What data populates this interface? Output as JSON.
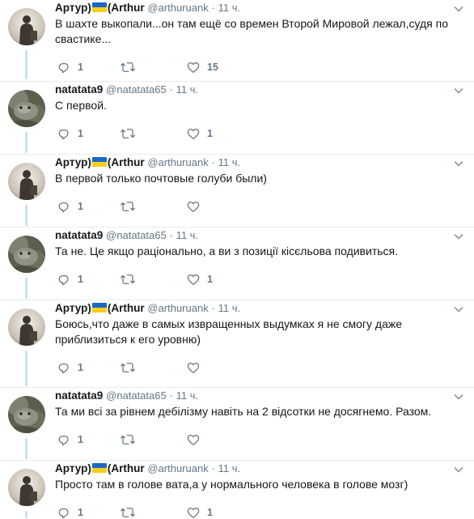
{
  "tweets": [
    {
      "author": "arthur",
      "name": "Артур)",
      "name2": "(Arthur",
      "handle": "@arthuruank",
      "dot": "·",
      "time": "11 ч.",
      "lines": [
        "В шахте выкопали...он там ещё со времен Второй Мировой лежал,судя по",
        "свастике..."
      ],
      "replies": "1",
      "retweets": "",
      "likes": "15"
    },
    {
      "author": "natatata",
      "name": "natatata9",
      "name2": "",
      "handle": "@natatata65",
      "dot": "·",
      "time": "11 ч.",
      "lines": [
        "С первой."
      ],
      "replies": "1",
      "retweets": "",
      "likes": "1"
    },
    {
      "author": "arthur",
      "name": "Артур)",
      "name2": "(Arthur",
      "handle": "@arthuruank",
      "dot": "·",
      "time": "11 ч.",
      "lines": [
        "В первой только почтовые голуби были)"
      ],
      "replies": "1",
      "retweets": "",
      "likes": ""
    },
    {
      "author": "natatata",
      "name": "natatata9",
      "name2": "",
      "handle": "@natatata65",
      "dot": "·",
      "time": "11 ч.",
      "lines": [
        "Та не. Це якщо раціонально, а ви з позиції кісєльова подивиться."
      ],
      "replies": "1",
      "retweets": "",
      "likes": "1"
    },
    {
      "author": "arthur",
      "name": "Артур)",
      "name2": "(Arthur",
      "handle": "@arthuruank",
      "dot": "·",
      "time": "11 ч.",
      "lines": [
        "Боюсь,что даже в самых извращенных выдумках я не смогу даже",
        "приблизиться к его уровню)"
      ],
      "replies": "1",
      "retweets": "",
      "likes": ""
    },
    {
      "author": "natatata",
      "name": "natatata9",
      "name2": "",
      "handle": "@natatata65",
      "dot": "·",
      "time": "11 ч.",
      "lines": [
        "Та ми всі за рівнем дебілізму навіть на 2 відсотки не досягнемо.  Разом."
      ],
      "replies": "1",
      "retweets": "",
      "likes": ""
    },
    {
      "author": "arthur",
      "name": "Артур)",
      "name2": "(Arthur",
      "handle": "@arthuruank",
      "dot": "·",
      "time": "11 ч.",
      "lines": [
        "Просто там в голове вата,а у нормального человека в голове мозг)"
      ],
      "replies": "1",
      "retweets": "",
      "likes": "1"
    }
  ],
  "colors": {
    "icon_gray": "#657786",
    "thread_line": "#c4e3f5",
    "divider": "#e6ecf0",
    "flag_blue": "#1a68c9",
    "flag_yellow": "#f7cf1d"
  },
  "icons": {
    "reply": "reply-icon",
    "retweet": "retweet-icon",
    "like": "heart-icon",
    "menu": "chevron-down-icon"
  }
}
